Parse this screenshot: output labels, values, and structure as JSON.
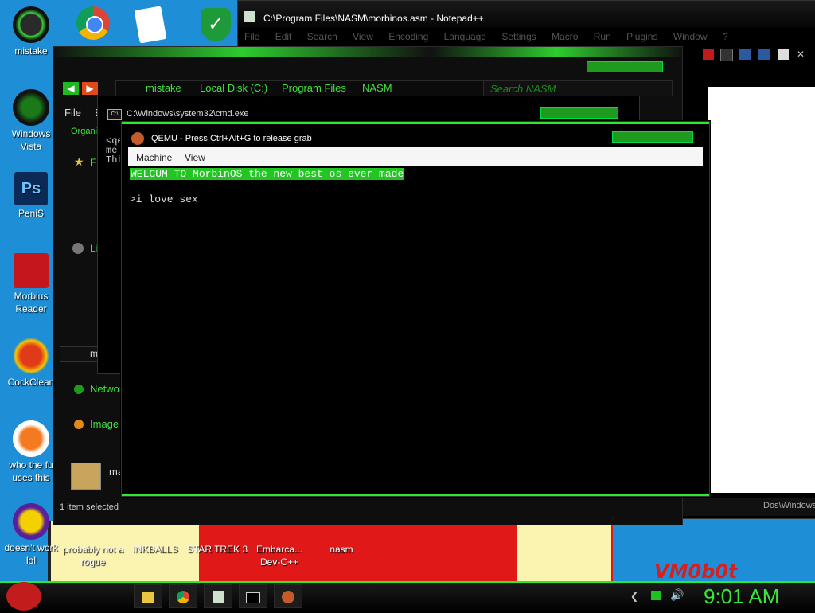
{
  "desktop": {
    "icons": [
      {
        "label": "mistake",
        "icon": "green-circle-icon"
      },
      {
        "label": "Windows Vista",
        "icon": "recycle-bin-icon"
      },
      {
        "label": "PeniS",
        "icon": "photoshop-icon"
      },
      {
        "label": "Morbius Reader",
        "icon": "adobe-reader-icon"
      },
      {
        "label": "CockClean",
        "icon": "ccleaner-icon"
      },
      {
        "label": "who the fu uses this",
        "icon": "lightning-icon"
      },
      {
        "label": "doesn't work lol",
        "icon": "yahoo-messenger-icon"
      },
      {
        "label": "probably not a rogue",
        "icon": "program-icon"
      },
      {
        "label": "INKBALLS",
        "icon": "inkball-icon"
      },
      {
        "label": "STAR TREK 3",
        "icon": "star-wars-icon"
      },
      {
        "label": "Embarca... Dev-C++",
        "icon": "dev-cpp-icon"
      },
      {
        "label": "nasm",
        "icon": "nasm-icon"
      }
    ],
    "shield_icon": "security-shield-icon",
    "chrome_icon": "chrome-icon",
    "solitaire_icon": "solitaire-icon",
    "wallpaper_text": "VM0b0t"
  },
  "notepadpp": {
    "title": "C:\\Program Files\\NASM\\morbinos.asm - Notepad++",
    "menu": [
      "File",
      "Edit",
      "Search",
      "View",
      "Encoding",
      "Language",
      "Settings",
      "Macro",
      "Run",
      "Plugins",
      "Window",
      "?"
    ],
    "status": "Dos\\Windows"
  },
  "explorer": {
    "breadcrumbs": [
      "mistake",
      "Local Disk (C:)",
      "Program Files",
      "NASM"
    ],
    "search_placeholder": "Search NASM",
    "menu_file": "File",
    "menu_e": "E",
    "organize": "Organi",
    "nav_f": "F",
    "nav_li": "Li",
    "nav_m": "m",
    "network": "Networ",
    "image": "Image",
    "selected_name": "ma",
    "status": "1 item selected"
  },
  "cmd": {
    "title": "C:\\Windows\\system32\\cmd.exe",
    "lines": "<qe\nme\nThi"
  },
  "qemu": {
    "title": "QEMU - Press Ctrl+Alt+G to release grab",
    "menu": [
      "Machine",
      "View"
    ],
    "welcome": "WELCUM TO MorbinOS the new best os ever made",
    "prompt": ">i love sex"
  },
  "taskbar": {
    "clock": "9:01 AM",
    "buttons": [
      "explorer-folder-icon",
      "chrome-icon",
      "notepad-icon",
      "cmd-icon",
      "qemu-icon"
    ],
    "tray": [
      "back-arrow-icon",
      "network-icon",
      "volume-icon"
    ]
  }
}
